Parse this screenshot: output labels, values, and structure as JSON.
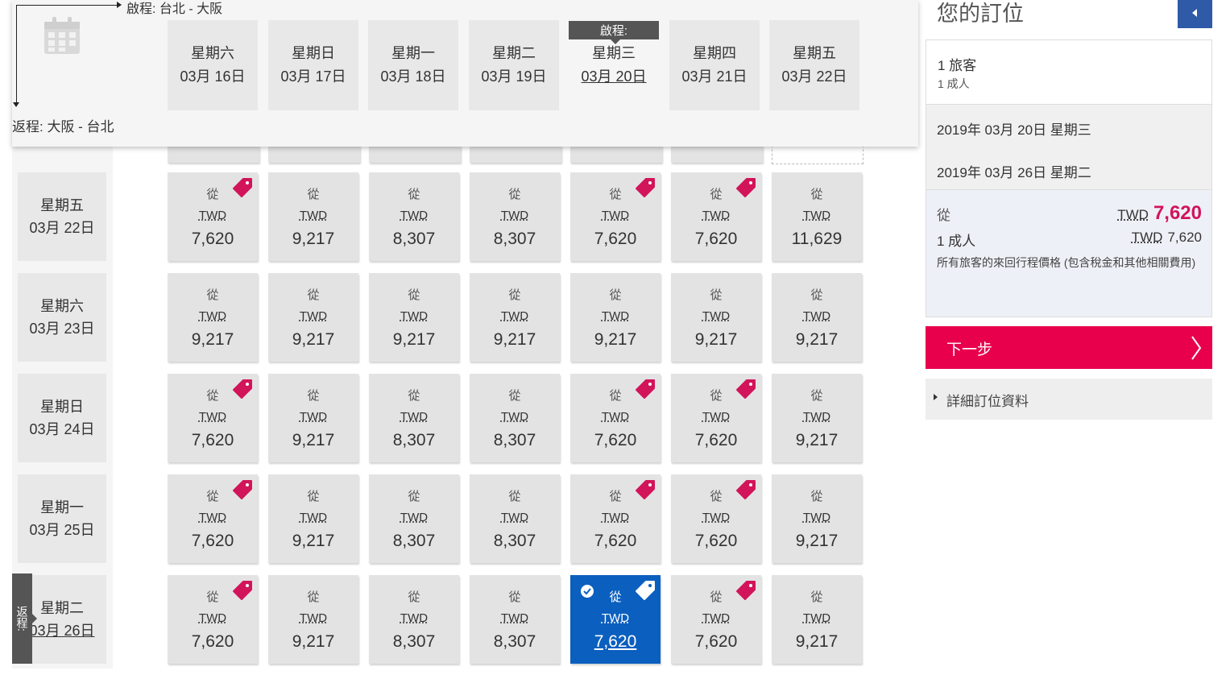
{
  "header": {
    "departure_label": "啟程: 台北 - 大阪",
    "return_label": "返程: 大阪 - 台北",
    "selected_badge": "啟程:",
    "departure_dates": [
      {
        "weekday": "星期六",
        "date": "03月 16日"
      },
      {
        "weekday": "星期日",
        "date": "03月 17日"
      },
      {
        "weekday": "星期一",
        "date": "03月 18日"
      },
      {
        "weekday": "星期二",
        "date": "03月 19日"
      },
      {
        "weekday": "星期三",
        "date": "03月 20日"
      },
      {
        "weekday": "星期四",
        "date": "03月 21日"
      },
      {
        "weekday": "星期五",
        "date": "03月 22日"
      }
    ],
    "selected_departure_index": 4
  },
  "return_rows": [
    {
      "weekday": "星期五",
      "date": "03月 22日"
    },
    {
      "weekday": "星期六",
      "date": "03月 23日"
    },
    {
      "weekday": "星期日",
      "date": "03月 24日"
    },
    {
      "weekday": "星期一",
      "date": "03月 25日"
    },
    {
      "weekday": "星期二",
      "date": "03月 26日"
    }
  ],
  "return_tab_label": "返程:",
  "grid": {
    "from_label": "從",
    "currency": "TWD",
    "rows": [
      [
        "7,620",
        "9,217",
        "8,307",
        "8,307",
        "7,620",
        "7,620",
        "11,629"
      ],
      [
        "9,217",
        "9,217",
        "9,217",
        "9,217",
        "9,217",
        "9,217",
        "9,217"
      ],
      [
        "7,620",
        "9,217",
        "8,307",
        "8,307",
        "7,620",
        "7,620",
        "9,217"
      ],
      [
        "7,620",
        "9,217",
        "8,307",
        "8,307",
        "7,620",
        "7,620",
        "9,217"
      ],
      [
        "7,620",
        "9,217",
        "8,307",
        "8,307",
        "7,620",
        "7,620",
        "9,217"
      ]
    ],
    "lowest_price_tag_rows": [
      [
        true,
        false,
        false,
        false,
        true,
        true,
        false
      ],
      [
        false,
        false,
        false,
        false,
        false,
        false,
        false
      ],
      [
        true,
        false,
        false,
        false,
        true,
        true,
        false
      ],
      [
        true,
        false,
        false,
        false,
        true,
        true,
        false
      ],
      [
        true,
        false,
        false,
        false,
        true,
        true,
        false
      ]
    ],
    "selected": {
      "row": 4,
      "col": 4
    }
  },
  "summary": {
    "title": "您的訂位",
    "pax_count": "1 旅客",
    "pax_detail": "1 成人",
    "depart_date": "2019年 03月 20日 星期三",
    "return_date": "2019年 03月 26日 星期二",
    "from_label": "從",
    "total_currency": "TWD",
    "total_price": "7,620",
    "adult_label": "1 成人",
    "adult_currency": "TWD",
    "adult_price": "7,620",
    "note": "所有旅客的來回行程價格 (包含稅金和其他相關費用)",
    "next_button": "下一步",
    "details_link": "詳細訂位資料"
  },
  "colors": {
    "accent_blue": "#0b5fbf",
    "next_red": "#e8004d",
    "tag_pink": "#d2145a",
    "price_red": "#d2145a"
  }
}
